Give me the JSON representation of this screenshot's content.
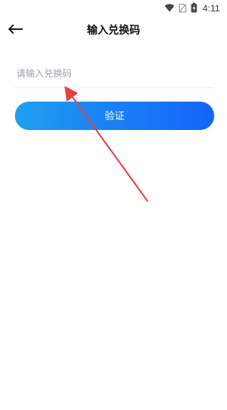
{
  "status_bar": {
    "time": "4:11",
    "icons": [
      "wifi-icon",
      "no-sim-icon",
      "battery-charging-icon"
    ]
  },
  "header": {
    "title": "输入兑换码",
    "back_icon": "arrow-left-icon"
  },
  "form": {
    "code_input": {
      "placeholder": "请输入兑换码",
      "value": ""
    },
    "verify_label": "验证"
  },
  "colors": {
    "button_gradient_start": "#1fa0ef",
    "button_gradient_end": "#1466f9",
    "annotation_arrow": "#e8403a",
    "placeholder_text": "#9aa2ad"
  }
}
